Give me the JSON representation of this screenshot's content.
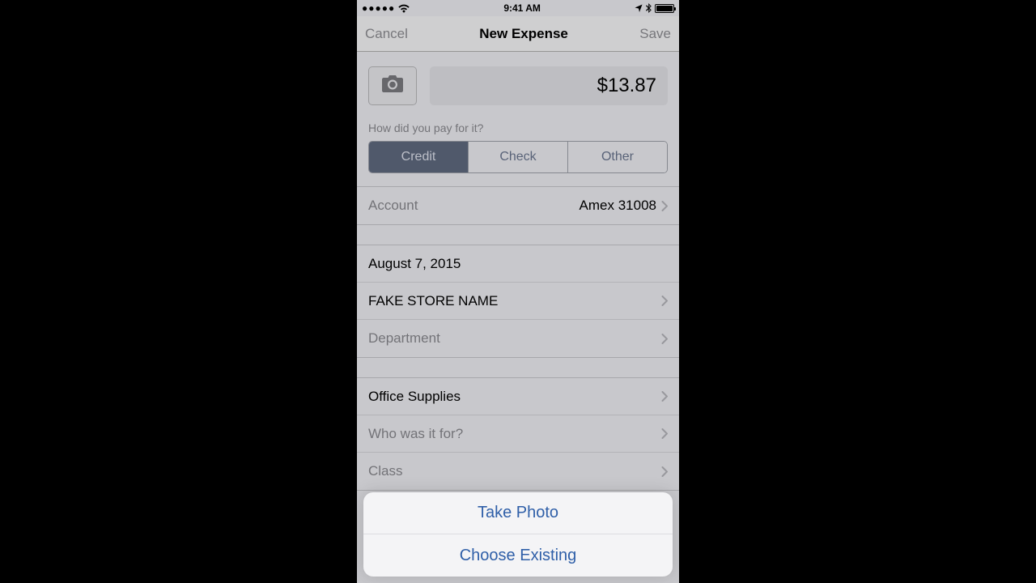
{
  "status": {
    "carrier_dots": "●●●●●",
    "time": "9:41 AM"
  },
  "nav": {
    "cancel": "Cancel",
    "title": "New Expense",
    "save": "Save"
  },
  "amount": "$13.87",
  "pay_question": "How did you pay for it?",
  "segments": {
    "credit": "Credit",
    "check": "Check",
    "other": "Other"
  },
  "account": {
    "label": "Account",
    "value": "Amex 31008"
  },
  "details": {
    "date": "August 7, 2015",
    "store": "FAKE STORE NAME",
    "department": "Department"
  },
  "cat": {
    "category": "Office Supplies",
    "who": "Who was it for?",
    "class": "Class"
  },
  "sheet": {
    "take_photo": "Take Photo",
    "choose_existing": "Choose Existing"
  }
}
